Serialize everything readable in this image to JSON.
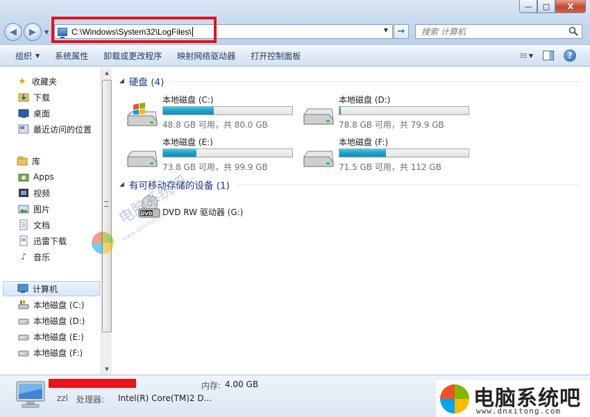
{
  "window": {
    "minimize_label": "—",
    "maximize_label": "□",
    "close_label": "X"
  },
  "address_bar": {
    "path": "C:\\Windows\\System32\\LogFiles\\",
    "go_label": "→"
  },
  "search": {
    "placeholder": "搜索 计算机"
  },
  "toolbar": {
    "organize": "组织",
    "system_properties": "系统属性",
    "uninstall_change": "卸载或更改程序",
    "map_network_drive": "映射网络驱动器",
    "open_control_panel": "打开控制面板",
    "help": "?"
  },
  "sidebar": {
    "favorites": {
      "label": "收藏夹",
      "items": [
        "下载",
        "桌面",
        "最近访问的位置"
      ]
    },
    "libraries": {
      "label": "库",
      "items": [
        "Apps",
        "视频",
        "图片",
        "文档",
        "迅雷下载",
        "音乐"
      ]
    },
    "computer": {
      "label": "计算机",
      "items": [
        "本地磁盘 (C:)",
        "本地磁盘 (D:)",
        "本地磁盘 (E:)",
        "本地磁盘 (F:)"
      ]
    }
  },
  "main": {
    "hard_disks": {
      "header": "硬盘 (4)",
      "drives": [
        {
          "name": "本地磁盘 (C:)",
          "info": "48.8 GB 可用，共 80.0 GB",
          "used_fraction": 0.39
        },
        {
          "name": "本地磁盘 (D:)",
          "info": "78.8 GB 可用，共 79.9 GB",
          "used_fraction": 0.01
        },
        {
          "name": "本地磁盘 (E:)",
          "info": "73.8 GB 可用，共 99.9 GB",
          "used_fraction": 0.26
        },
        {
          "name": "本地磁盘 (F:)",
          "info": "71.5 GB 可用，共 112 GB",
          "used_fraction": 0.36
        }
      ]
    },
    "removable": {
      "header": "有可移动存储的设备 (1)",
      "devices": [
        {
          "name": "DVD RW 驱动器 (G:)",
          "badge": "DVD"
        }
      ]
    }
  },
  "watermark_center": {
    "text": "电脑系统吧",
    "url": "www.dnxitong.com"
  },
  "status": {
    "computer_name": "zzl",
    "cpu_label": "处理器:",
    "cpu_value": "Intel(R) Core(TM)2 D...",
    "memory_label": "内存:",
    "memory_value": "4.00 GB"
  },
  "watermark_corner": {
    "title": "电脑系统吧",
    "url": "www.dnxitong.com"
  },
  "colors": {
    "accent": "#1e3287",
    "fill": "#1c9fc9",
    "highlight": "#e4121a"
  }
}
